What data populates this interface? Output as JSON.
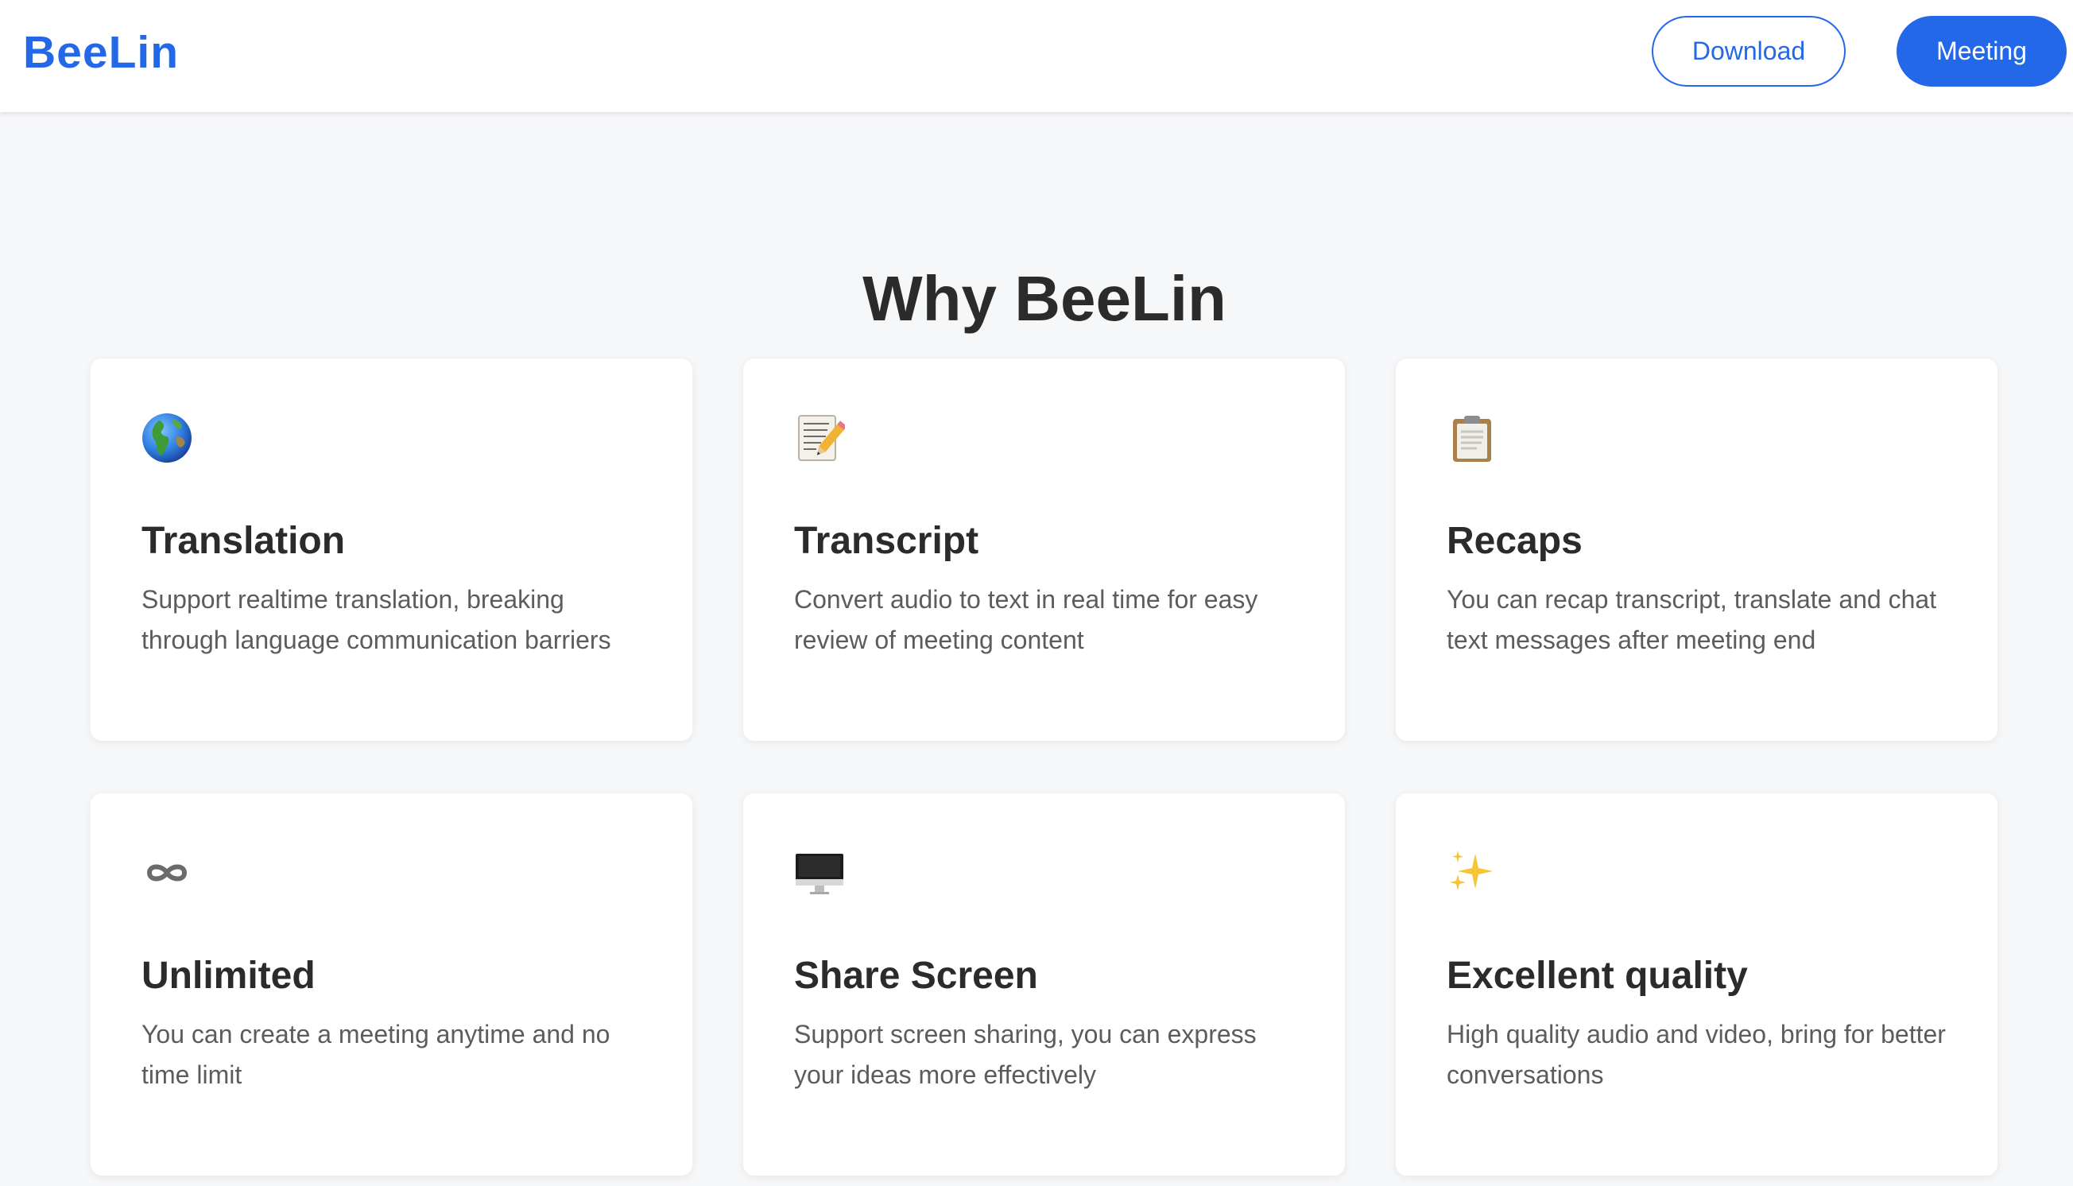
{
  "header": {
    "logo": "BeeLin",
    "download_label": "Download",
    "meeting_label": "Meeting"
  },
  "colors": {
    "brand": "#2368e8",
    "button_primary": "#2368e8",
    "page_background": "#f6f7f9"
  },
  "section": {
    "title": "Why BeeLin"
  },
  "features": [
    {
      "icon": "globe-icon",
      "title": "Translation",
      "description": "Support realtime translation, breaking through language communication barriers"
    },
    {
      "icon": "memo-pencil-icon",
      "title": "Transcript",
      "description": "Convert audio to text in real time for easy review of meeting content"
    },
    {
      "icon": "clipboard-icon",
      "title": "Recaps",
      "description": "You can recap transcript, translate and chat text messages after meeting end"
    },
    {
      "icon": "infinity-icon",
      "title": "Unlimited",
      "description": "You can create a meeting anytime and no time limit"
    },
    {
      "icon": "monitor-icon",
      "title": "Share Screen",
      "description": "Support screen sharing, you can express your ideas more effectively"
    },
    {
      "icon": "sparkles-icon",
      "title": "Excellent quality",
      "description": "High quality audio and video, bring for better conversations"
    }
  ]
}
